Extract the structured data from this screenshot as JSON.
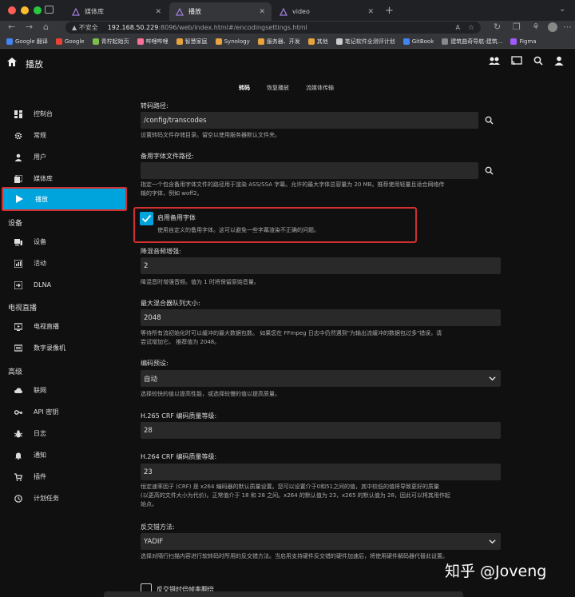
{
  "browser": {
    "tabs": [
      {
        "label": "媒体库"
      },
      {
        "label": "播放"
      },
      {
        "label": "video"
      }
    ],
    "url": {
      "insecure": "不安全",
      "host": "192.168.50.229",
      "path": ":8096/web/index.html#/encodingsettings.html"
    },
    "bookmarks": [
      {
        "label": "Google 翻译",
        "color": "#4285f4"
      },
      {
        "label": "Google",
        "color": "#ea4335"
      },
      {
        "label": "青柠起始页",
        "color": "#7cc04b"
      },
      {
        "label": "哔哩哔哩",
        "color": "#fb7299"
      },
      {
        "label": "智慧家庭",
        "color": "#e8a33d"
      },
      {
        "label": "Synology",
        "color": "#e8a33d"
      },
      {
        "label": "服务器、开发",
        "color": "#e8a33d"
      },
      {
        "label": "其他",
        "color": "#e8a33d"
      },
      {
        "label": "笔记软件全测评计划",
        "color": "#cccccc"
      },
      {
        "label": "GitBook",
        "color": "#4285f4"
      },
      {
        "label": "建筑曲奇导航-建筑...",
        "color": "#888888"
      },
      {
        "label": "Figma",
        "color": "#a259ff"
      }
    ]
  },
  "header": {
    "title": "播放",
    "subtabs": [
      {
        "label": "转码"
      },
      {
        "label": "恢复播放"
      },
      {
        "label": "流媒体传输"
      }
    ]
  },
  "sidebar": {
    "items_top": [
      {
        "label": "控制台"
      },
      {
        "label": "常规"
      },
      {
        "label": "用户"
      },
      {
        "label": "媒体库"
      },
      {
        "label": "播放"
      }
    ],
    "section_devices": "设备",
    "items_devices": [
      {
        "label": "设备"
      },
      {
        "label": "活动"
      },
      {
        "label": "DLNA"
      }
    ],
    "section_tv": "电视直播",
    "items_tv": [
      {
        "label": "电视直播"
      },
      {
        "label": "数字录像机"
      }
    ],
    "section_advanced": "高级",
    "items_advanced": [
      {
        "label": "联网"
      },
      {
        "label": "API 密钥"
      },
      {
        "label": "日志"
      },
      {
        "label": "通知"
      },
      {
        "label": "插件"
      },
      {
        "label": "计划任务"
      }
    ]
  },
  "form": {
    "transcode_path_label": "转码路径:",
    "transcode_path_value": "/config/transcodes",
    "transcode_path_help": "设置转码文件存储目录。留空以使用服务器默认文件夹。",
    "fallback_font_label": "备用字体文件路径:",
    "fallback_font_value": "",
    "fallback_font_help1": "指定一个包含备用字体文件的路径用于渲染 ASS/SSA 字幕。允许的最大字体总容量为 20 MB。推荐使用轻量且适合网络传",
    "fallback_font_help2": "输的字体，例如 woff2。",
    "enable_fallback_label": "启用备用字体",
    "enable_fallback_help": "使用自定义的备用字体。这可以避免一些字幕渲染不正确的问题。",
    "downmix_label": "降混音频增强:",
    "downmix_value": "2",
    "downmix_help": "降混音时增强音频。值为 1 时将保留原始音量。",
    "muxing_label": "最大混合器队列大小:",
    "muxing_value": "2048",
    "muxing_help1": "等待所有流初始化时可以缓冲的最大数据包数。 如果您在 FFmpeg 日志中仍然遇到\"为输出流缓冲的数据包过多\"错误，请",
    "muxing_help2": "尝试增加它。 推荐值为 2048。",
    "preset_label": "编码预设:",
    "preset_value": "自动",
    "preset_help": "选择较快的值以提高性能，或选择较慢的值以提高质量。",
    "h265_label": "H.265 CRF 编码质量等级:",
    "h265_value": "28",
    "h264_label": "H.264 CRF 编码质量等级:",
    "h264_value": "23",
    "crf_help1": "恒定速率因子 (CRF) 是 x264 编码器的默认质量设置。您可以设置介于0和51之间的值，其中较低的值将导致更好的质量",
    "crf_help2": "(以更高的文件大小为代价)。正常值介于 18 和 28 之间。x264 的默认值为 23，x265 的默认值为 28，因此可以将其用作起",
    "crf_help3": "始点。",
    "deint_label": "反交错方法:",
    "deint_value": "YADIF",
    "deint_help": "选择对隔行扫描内容进行软转码时所用的反交错方法。当启用支持硬件反交错的硬件加速后，将使用硬件解码器代替此设置。",
    "double_rate_label": "反交错时倍帧率翻倍"
  },
  "watermark": "知乎 @Joveng",
  "colors": {
    "accent": "#00a4dc",
    "highlight_border": "#d03030"
  }
}
